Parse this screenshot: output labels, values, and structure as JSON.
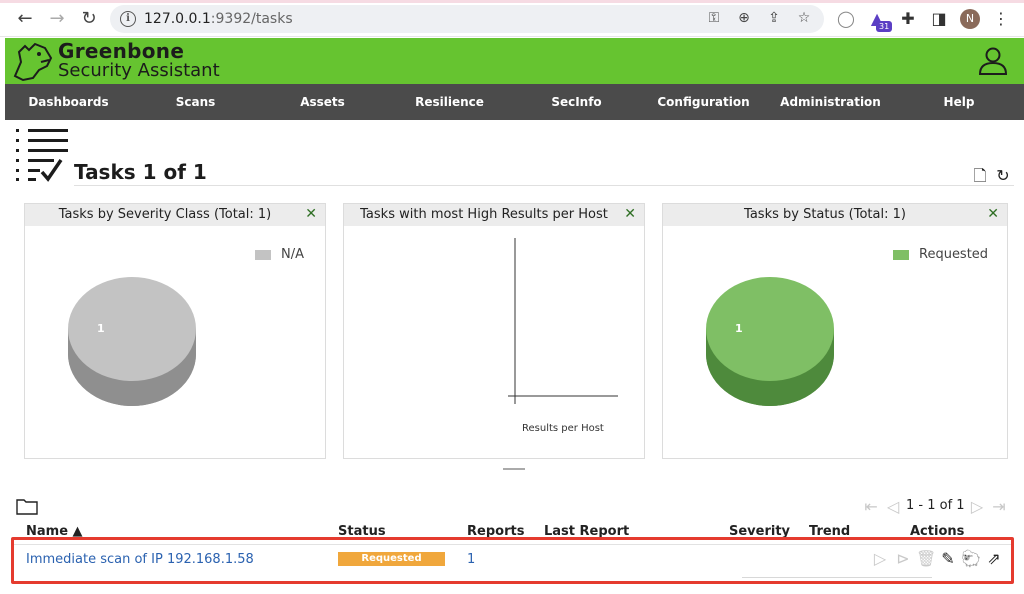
{
  "browser": {
    "url_host": "127.0.0.1",
    "url_rest": ":9392/tasks",
    "extension_badge": "31",
    "profile_initial": "N"
  },
  "brand": {
    "name_line1": "Greenbone",
    "name_line2": "Security Assistant"
  },
  "nav": [
    "Dashboards",
    "Scans",
    "Assets",
    "Resilience",
    "SecInfo",
    "Configuration",
    "Administration",
    "Help"
  ],
  "page": {
    "title": "Tasks 1 of 1"
  },
  "panels": {
    "severity": {
      "title": "Tasks by Severity Class (Total: 1)",
      "legend": "N/A",
      "pie_label": "1",
      "color": "#c3c3c3"
    },
    "high_results": {
      "title": "Tasks with most High Results per Host",
      "axis_label": "Results per Host"
    },
    "status": {
      "title": "Tasks by Status (Total: 1)",
      "legend": "Requested",
      "pie_label": "1",
      "color": "#7fbf65"
    }
  },
  "pager": {
    "text": "1 - 1 of 1"
  },
  "table": {
    "headers": {
      "name": "Name ▲",
      "status": "Status",
      "reports": "Reports",
      "last_report": "Last Report",
      "severity": "Severity",
      "trend": "Trend",
      "actions": "Actions"
    },
    "rows": [
      {
        "name": "Immediate scan of IP 192.168.1.58",
        "status": "Requested",
        "reports": "1",
        "last_report": "",
        "severity": "",
        "trend": ""
      }
    ]
  },
  "colors": {
    "brand_green": "#66c430",
    "nav_dark": "#4b4b4b",
    "status_requested": "#f0a73c",
    "highlight_red": "#e53b2f"
  }
}
